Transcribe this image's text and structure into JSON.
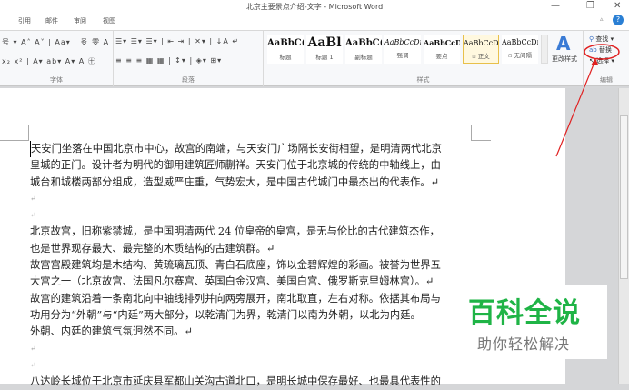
{
  "window": {
    "title": "北京主要景点介绍-文字 - Microsoft Word",
    "minimize": "—",
    "restore": "❐",
    "close": "✕"
  },
  "tabs": [
    "引用",
    "邮件",
    "审阅",
    "视图"
  ],
  "ribbon": {
    "font_row1": "号 ▾ A˄ A˅ | Aa▾ | 㕛 雯 A",
    "font_row2": "x₂ x² | A▾ ab▾ A▾ A ㊉",
    "font_group": "字体",
    "para_row1": "☰▾ ☰▾ ☰▾ | ⇤ ⇥ | ✕▾ | ↓A ↵",
    "para_row2": "≡ ≡ ≡ ▦ ▦ | ↕▾ | ◈▾ ⊞▾",
    "para_group": "段落",
    "styles": [
      {
        "preview": "AaBbC(",
        "name": "标题"
      },
      {
        "preview": "AaBl",
        "name": "标题 1"
      },
      {
        "preview": "AaBbC(",
        "name": "副标题"
      },
      {
        "preview": "AaBbCcDı",
        "name": "强调"
      },
      {
        "preview": "AaBbCcD",
        "name": "要点"
      },
      {
        "preview": "AaBbCcDı",
        "name": "▫ 正文"
      },
      {
        "preview": "AaBbCcDı",
        "name": "▫ 无间隔"
      }
    ],
    "styles_group": "样式",
    "change_styles": "更改样式",
    "find": "查找 ▾",
    "replace": "替换",
    "select": "选择 ▾",
    "editing_group": "编辑",
    "annotation_color": "#e02020"
  },
  "document": {
    "paragraphs": [
      "天安门坐落在中国北京市中心，故宫的南端，与天安门广场隔长安街相望，是明清两代北京",
      "皇城的正门。设计者为明代的御用建筑匠师蒯祥。天安门位于北京城的传统的中轴线上，由",
      "城台和城楼两部分组成，造型威严庄重，气势宏大，是中国古代城门中最杰出的代表作。↵",
      "↵",
      "↵",
      "北京故宫，旧称紫禁城，是中国明清两代 24 位皇帝的皇宫，是无与伦比的古代建筑杰作，",
      "也是世界现存最大、最完整的木质结构的古建筑群。↵",
      "故宫宫殿建筑均是木结构、黄琉璃瓦顶、青白石底座，饰以金碧辉煌的彩画。被誉为世界五",
      "大宫之一（北京故宫、法国凡尔赛宫、英国白金汉宫、美国白宫、俄罗斯克里姆林宫）。↵",
      "故宫的建筑沿着一条南北向中轴线排列并向两旁展开，南北取直，左右对称。依据其布局与",
      "功用分为“外朝”与“内廷”两大部分，以乾清门为界，乾清门以南为外朝，以北为内廷。",
      "外朝、内廷的建筑气氛迥然不同。↵",
      "↵",
      "↵",
      "八达岭长城位于北京市延庆县军都山关沟古道北口，是明长城中保存最好、也最具代表性的"
    ]
  },
  "watermark": {
    "title": "百科全说",
    "subtitle": "助你轻松解决"
  }
}
